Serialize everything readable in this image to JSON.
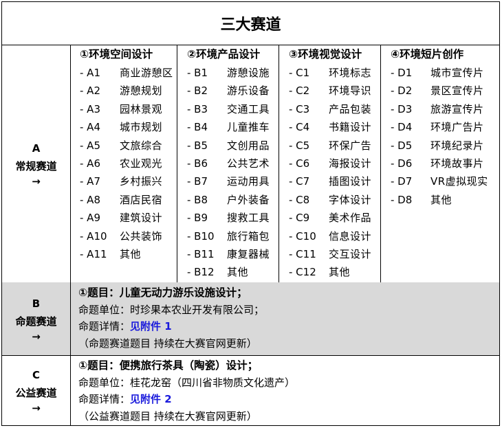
{
  "title": "三大赛道",
  "tracks": {
    "A": {
      "letter": "A",
      "name": "常规赛道",
      "arrow": "→",
      "columns": [
        {
          "heading": "①环境空间设计",
          "items": [
            {
              "code": "A1",
              "name": "商业游憩区"
            },
            {
              "code": "A2",
              "name": "游憩规划"
            },
            {
              "code": "A3",
              "name": "园林景观"
            },
            {
              "code": "A4",
              "name": "城市规划"
            },
            {
              "code": "A5",
              "name": "文旅综合"
            },
            {
              "code": "A6",
              "name": "农业观光"
            },
            {
              "code": "A7",
              "name": "乡村振兴"
            },
            {
              "code": "A8",
              "name": "酒店民宿"
            },
            {
              "code": "A9",
              "name": "建筑设计"
            },
            {
              "code": "A10",
              "name": "公共装饰"
            },
            {
              "code": "A11",
              "name": "其他"
            }
          ]
        },
        {
          "heading": "②环境产品设计",
          "items": [
            {
              "code": "B1",
              "name": "游憩设施"
            },
            {
              "code": "B2",
              "name": "游乐设备"
            },
            {
              "code": "B3",
              "name": "交通工具"
            },
            {
              "code": "B4",
              "name": "儿童推车"
            },
            {
              "code": "B5",
              "name": "文创用品"
            },
            {
              "code": "B6",
              "name": "公共艺术"
            },
            {
              "code": "B7",
              "name": "运动用具"
            },
            {
              "code": "B8",
              "name": "户外装备"
            },
            {
              "code": "B9",
              "name": "搜救工具"
            },
            {
              "code": "B10",
              "name": "旅行箱包"
            },
            {
              "code": "B11",
              "name": "康复器械"
            },
            {
              "code": "B12",
              "name": "其他"
            }
          ]
        },
        {
          "heading": "③环境视觉设计",
          "items": [
            {
              "code": "C1",
              "name": "环境标志"
            },
            {
              "code": "C2",
              "name": "环境导识"
            },
            {
              "code": "C3",
              "name": "产品包装"
            },
            {
              "code": "C4",
              "name": "书籍设计"
            },
            {
              "code": "C5",
              "name": "环保广告"
            },
            {
              "code": "C6",
              "name": "海报设计"
            },
            {
              "code": "C7",
              "name": "插图设计"
            },
            {
              "code": "C8",
              "name": "字体设计"
            },
            {
              "code": "C9",
              "name": "美术作品"
            },
            {
              "code": "C10",
              "name": "信息设计"
            },
            {
              "code": "C11",
              "name": "交互设计"
            },
            {
              "code": "C12",
              "name": "其他"
            }
          ]
        },
        {
          "heading": "④环境短片创作",
          "items": [
            {
              "code": "D1",
              "name": "城市宣传片"
            },
            {
              "code": "D2",
              "name": "景区宣传片"
            },
            {
              "code": "D3",
              "name": "旅游宣传片"
            },
            {
              "code": "D4",
              "name": "环境广告片"
            },
            {
              "code": "D5",
              "name": "环境纪录片"
            },
            {
              "code": "D6",
              "name": "环境故事片"
            },
            {
              "code": "D7",
              "name": "VR虚拟现实"
            },
            {
              "code": "D8",
              "name": "其他"
            }
          ]
        }
      ]
    },
    "B": {
      "letter": "B",
      "name": "命题赛道",
      "arrow": "→",
      "topic": "①题目：儿童无动力游乐设施设计；",
      "unit": "命题单位：时珍果本农业开发有限公司；",
      "detail_label": "命题详情：",
      "detail_link": "见附件 1",
      "note": "（命题赛道题目  持续在大赛官网更新）"
    },
    "C": {
      "letter": "C",
      "name": "公益赛道",
      "arrow": "→",
      "topic": "①题目：便携旅行茶具（陶瓷）设计；",
      "unit": "命题单位：桂花龙窑（四川省非物质文化遗产）",
      "detail_label": "命题详情：",
      "detail_link": "见附件 2",
      "note": "（公益赛道题目  持续在大赛官网更新）"
    }
  }
}
